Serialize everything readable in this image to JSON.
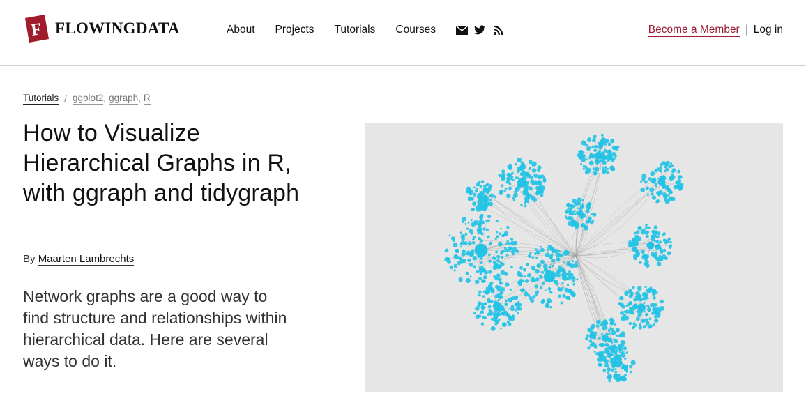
{
  "brand": {
    "name": "FLOWINGDATA",
    "mark_letter": "F",
    "mark_color": "#a01c2c"
  },
  "nav": {
    "items": [
      "About",
      "Projects",
      "Tutorials",
      "Courses"
    ],
    "social_icons": [
      "mail-icon",
      "twitter-icon",
      "rss-icon"
    ]
  },
  "account": {
    "member_label": "Become a Member",
    "separator": "|",
    "login_label": "Log in"
  },
  "breadcrumb": {
    "section": "Tutorials",
    "divider": "/",
    "tags": [
      "ggplot2",
      "ggraph",
      "R"
    ]
  },
  "article": {
    "title": "How to Visualize Hierarchical Graphs in R, with ggraph and tidygraph",
    "by_label": "By",
    "author": "Maarten Lambrechts",
    "dek": "Network graphs are a good way to find structure and relationships within hierarchical data. Here are several ways to do it."
  },
  "colors": {
    "accent": "#9e1b32",
    "node": "#22c3e6",
    "edge": "#9a9a9a",
    "hero_bg": "#e6e6e6"
  }
}
